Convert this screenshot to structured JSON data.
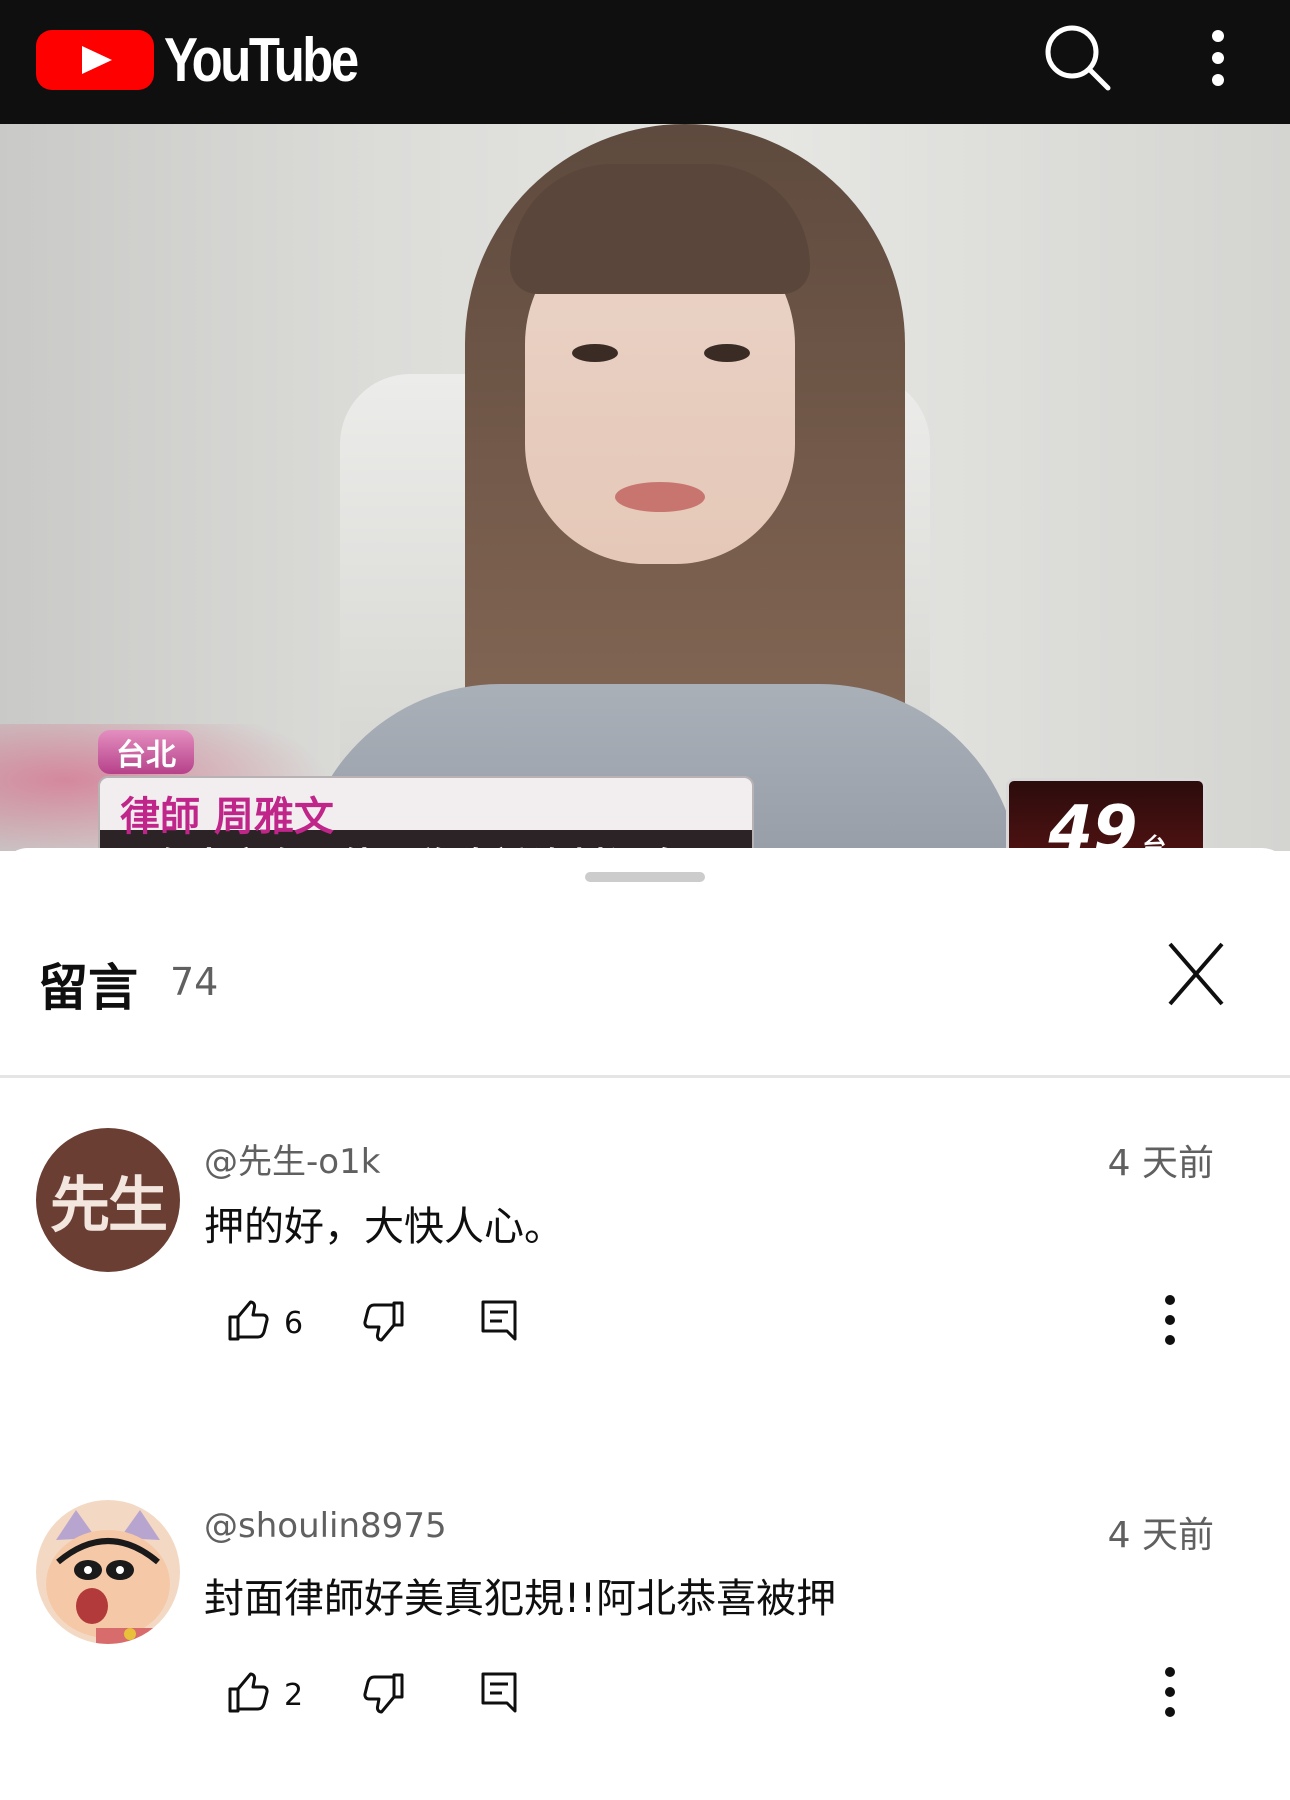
{
  "header": {
    "app_name": "YouTube",
    "search_icon": "search-icon",
    "menu_icon": "more-vert-icon"
  },
  "video": {
    "location_tag": "台北",
    "name_line": "律師 周雅文",
    "subtitle": "而在本案有可能因為卷證資料過多",
    "channel_badge_number": "49",
    "channel_badge_suffix": "台"
  },
  "comments_panel": {
    "title": "留言",
    "count": "74",
    "close_icon": "close-icon"
  },
  "comments": [
    {
      "avatar_text": "先生",
      "author": "@先生-o1k",
      "time": "4 天前",
      "text": "押的好，大快人心。",
      "likes": "6"
    },
    {
      "avatar_text": "",
      "author": "@shoulin8975",
      "time": "4 天前",
      "text": "封面律師好美真犯規!!阿北恭喜被押",
      "likes": "2"
    }
  ],
  "colors": {
    "youtube_red": "#ff0000",
    "topbar": "#0f0f0f",
    "secondary_text": "#606060"
  }
}
